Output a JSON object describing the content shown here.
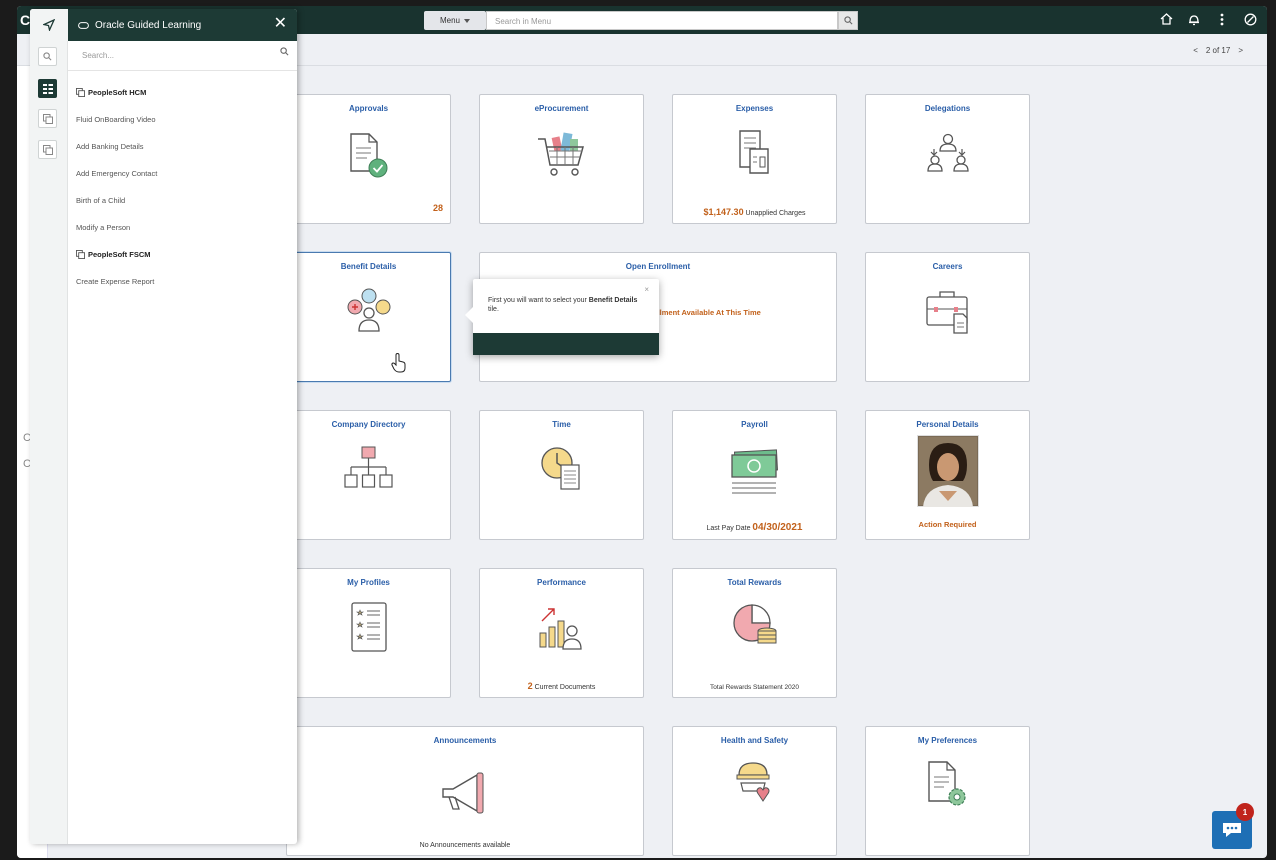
{
  "topbar": {
    "logo_glyph": "C",
    "menu_label": "Menu",
    "search_placeholder": "Search in Menu",
    "icons": [
      "home-icon",
      "bell-icon",
      "kebab-menu-icon",
      "compass-icon"
    ]
  },
  "pager": {
    "prev": "<",
    "text": "2 of 17",
    "next": ">"
  },
  "side_fragments": [
    "C",
    "C"
  ],
  "guided_learning": {
    "title": "Oracle Guided Learning",
    "close": "✕",
    "search_placeholder": "Search...",
    "items": [
      {
        "label": "PeopleSoft HCM",
        "group": true
      },
      {
        "label": "Fluid OnBoarding Video",
        "group": false
      },
      {
        "label": "Add Banking Details",
        "group": false
      },
      {
        "label": "Add Emergency Contact",
        "group": false
      },
      {
        "label": "Birth of a Child",
        "group": false
      },
      {
        "label": "Modify a Person",
        "group": false
      },
      {
        "label": "PeopleSoft FSCM",
        "group": true
      },
      {
        "label": "Create Expense Report",
        "group": false
      }
    ]
  },
  "tiles": {
    "approvals": {
      "title": "Approvals",
      "count": "28"
    },
    "eprocurement": {
      "title": "eProcurement"
    },
    "expenses": {
      "title": "Expenses",
      "amount": "$1,147.30",
      "amount_label": "Unapplied Charges"
    },
    "delegations": {
      "title": "Delegations"
    },
    "benefit_details": {
      "title": "Benefit Details"
    },
    "open_enrollment": {
      "title": "Open Enrollment",
      "status": "ollment Available At This Time"
    },
    "careers": {
      "title": "Careers"
    },
    "company_directory": {
      "title": "Company Directory"
    },
    "time": {
      "title": "Time"
    },
    "payroll": {
      "title": "Payroll",
      "date_label": "Last Pay Date",
      "date": "04/30/2021"
    },
    "personal_details": {
      "title": "Personal Details",
      "status": "Action Required"
    },
    "my_profiles": {
      "title": "My Profiles"
    },
    "performance": {
      "title": "Performance",
      "count": "2",
      "count_label": "Current Documents"
    },
    "total_rewards": {
      "title": "Total Rewards",
      "footer": "Total Rewards Statement 2020"
    },
    "announcements": {
      "title": "Announcements",
      "footer": "No Announcements available"
    },
    "health_safety": {
      "title": "Health and Safety"
    },
    "my_preferences": {
      "title": "My Preferences"
    }
  },
  "callout": {
    "text_before": "First you will want to select your ",
    "text_bold": "Benefit Details",
    "text_after": " tile.",
    "close": "×"
  },
  "chat": {
    "badge": "1"
  },
  "colors": {
    "header": "#19332f",
    "accent": "#1d3a35",
    "tile_title": "#2a5ea8",
    "highlight": "#c2611b"
  }
}
